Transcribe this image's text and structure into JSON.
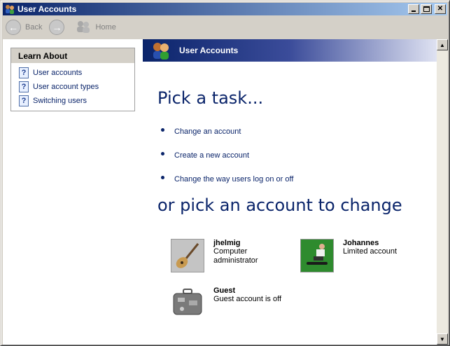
{
  "window": {
    "title": "User Accounts"
  },
  "toolbar": {
    "back_label": "Back",
    "home_label": "Home"
  },
  "learn_about": {
    "heading": "Learn About",
    "items": [
      {
        "label": "User accounts"
      },
      {
        "label": "User account types"
      },
      {
        "label": "Switching users"
      }
    ]
  },
  "banner": {
    "title": "User Accounts"
  },
  "main": {
    "task_heading": "Pick a task...",
    "tasks": [
      {
        "label": "Change an account"
      },
      {
        "label": "Create a new account"
      },
      {
        "label": "Change the way users log on or off"
      }
    ],
    "account_heading": "or pick an account to change",
    "accounts": [
      {
        "name": "jhelmig",
        "desc": "Computer administrator",
        "icon": "guitar-avatar-icon"
      },
      {
        "name": "Johannes",
        "desc": "Limited account",
        "icon": "skateboarder-avatar-icon"
      },
      {
        "name": "Guest",
        "desc": "Guest account is off",
        "icon": "suitcase-icon"
      }
    ]
  },
  "colors": {
    "titlebar": "#0a246a",
    "link": "#0a246a",
    "chrome": "#d4d0c8"
  }
}
